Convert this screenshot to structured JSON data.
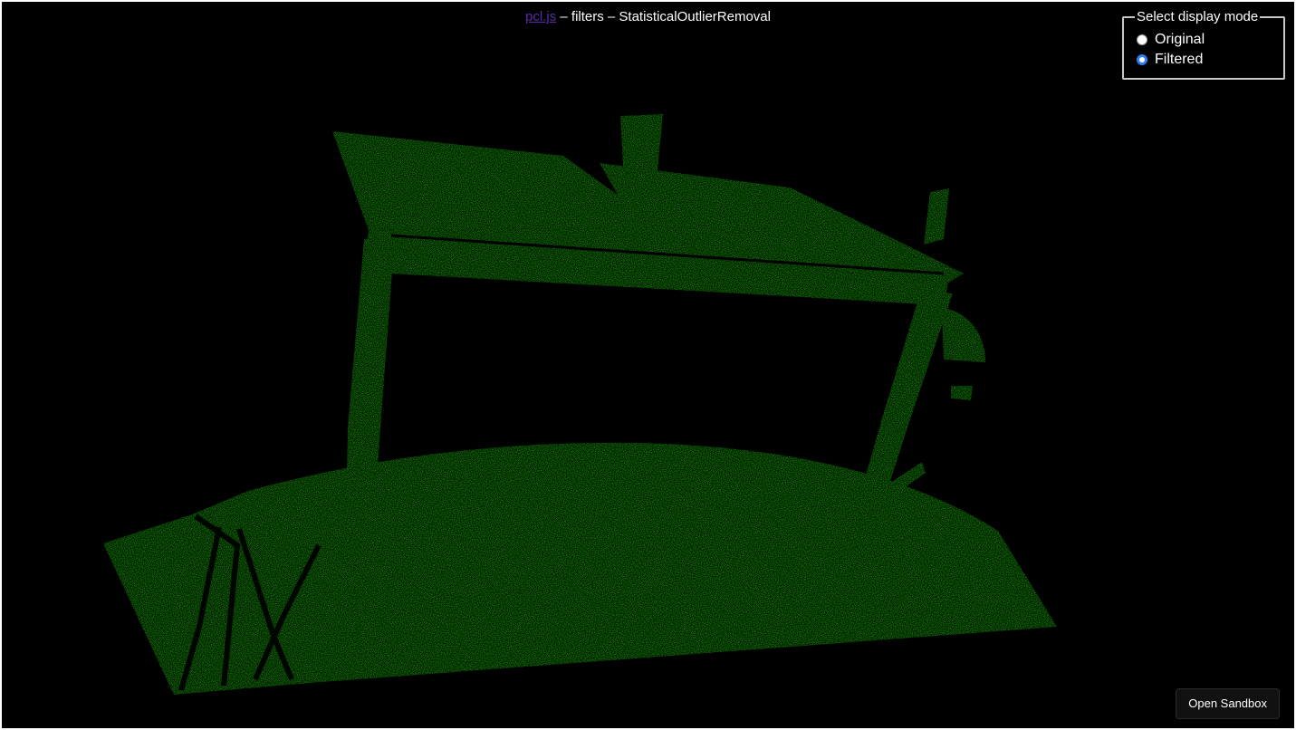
{
  "header": {
    "link_text": "pcl.js",
    "title_rest": " – filters – StatisticalOutlierRemoval"
  },
  "display_mode": {
    "legend": "Select display mode",
    "options": [
      {
        "label": "Original",
        "selected": false
      },
      {
        "label": "Filtered",
        "selected": true
      }
    ]
  },
  "sandbox_button": {
    "label": "Open Sandbox"
  },
  "colors": {
    "background": "#000000",
    "point_cloud": "#22ee11",
    "link": "#5a2aa8",
    "radio_selected": "#2f7cf6"
  }
}
